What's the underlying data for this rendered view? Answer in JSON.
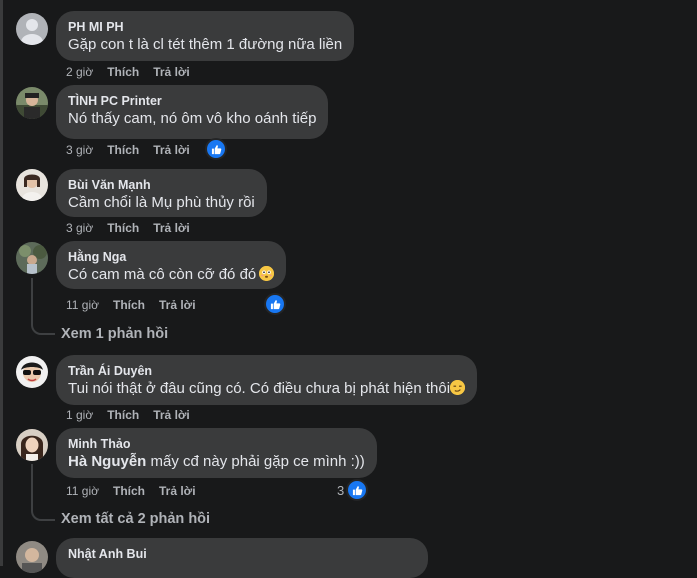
{
  "comments": [
    {
      "author": "PH MI PH",
      "text": "Gặp con t là cl tét thêm 1 đường nữa liền",
      "time": "2 giờ",
      "like": "Thích",
      "reply": "Trả lời"
    },
    {
      "author": "TÌNH PC Printer",
      "text": "Nó thấy cam, nó ôm vô kho oánh tiếp",
      "time": "3 giờ",
      "like": "Thích",
      "reply": "Trả lời"
    },
    {
      "author": "Bùi Văn Mạnh",
      "text": "Cầm chổi là Mụ phù thủy rồi",
      "time": "3 giờ",
      "like": "Thích",
      "reply": "Trả lời"
    },
    {
      "author": "Hằng Nga",
      "text": "Có cam mà cô còn cỡ đó đó",
      "time": "11 giờ",
      "like": "Thích",
      "reply": "Trả lời",
      "view_replies": "Xem 1 phản hồi"
    },
    {
      "author": "Trần Ái Duyên",
      "text": "Tui nói thật ở đâu cũng có. Có điều chưa bị phát hiện thôi",
      "time": "1 giờ",
      "like": "Thích",
      "reply": "Trả lời"
    },
    {
      "author": "Minh Thảo",
      "mention": "Hà Nguyễn",
      "text": " mấy cđ này phải gặp ce mình :))",
      "time": "11 giờ",
      "like": "Thích",
      "reply": "Trả lời",
      "reaction_count": "3",
      "view_replies": "Xem tất cả 2 phản hồi"
    },
    {
      "author": "Nhật Anh Bui"
    }
  ],
  "colors": {
    "background": "#18191a",
    "bubble": "#3a3b3c",
    "like_blue": "#1877f2",
    "muted_text": "#b0b3b8"
  },
  "icons": {
    "like": "thumbs-up-icon",
    "emoji_flushed": "flushed-face-emoji",
    "emoji_smirk": "smirking-face-emoji"
  }
}
